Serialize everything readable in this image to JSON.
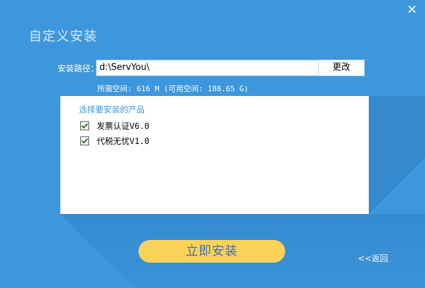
{
  "window": {
    "title": "自定义安装",
    "close_icon": "✕"
  },
  "install_path": {
    "label": "安装路径：",
    "value": "d:\\ServYou\\",
    "change_label": "更改"
  },
  "space_info": "所需空间: 616 M (可用空间: 188.65 G)",
  "products": {
    "heading": "选择要安装的产品",
    "items": [
      {
        "label": "发票认证V6.0",
        "checked": true
      },
      {
        "label": "代税无忧V1.0",
        "checked": true
      }
    ]
  },
  "actions": {
    "install_label": "立即安装",
    "back_label": "<<返回"
  },
  "colors": {
    "background": "#3d97dc",
    "install_button": "#fbd35a",
    "install_text": "#3f6faa"
  }
}
